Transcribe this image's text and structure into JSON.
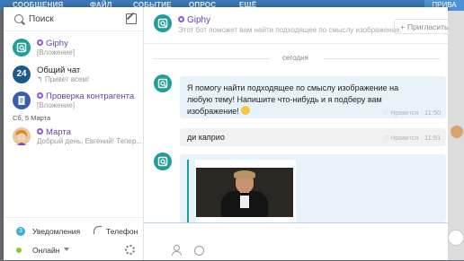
{
  "topbar": {
    "items": [
      "СООБЩЕНИЯ",
      "ФАЙЛ",
      "СОБЫТИЕ",
      "ОПРОС",
      "ЕЩЁ"
    ],
    "button": "ПРИВА"
  },
  "sidebar": {
    "search_placeholder": "Поиск",
    "chats": [
      {
        "name": "Giphy",
        "sub": "[Вложение]",
        "bot": true
      },
      {
        "name": "Общий чат",
        "sub": "Привет всем!",
        "bot": false,
        "avatar_text": "24"
      },
      {
        "name": "Проверка контрагента",
        "sub": "[Вложение]",
        "bot": true
      },
      {
        "name": "Марта",
        "sub": "Добрый день, Евгений! Тепер...",
        "bot": true
      }
    ],
    "date_separator": "Сб, 5 Марта",
    "notifications_count": "3",
    "notifications_label": "Уведомления",
    "phone_label": "Телефон",
    "status_label": "Онлайн"
  },
  "header": {
    "title": "Giphy",
    "subtitle": "Этот бот поможет вам найти подходящее по смыслу изображение.",
    "invite_label": "Пригласить"
  },
  "messages": {
    "day_separator": "сегодня",
    "m1_text": "Я помогу найти подходящее по смыслу изображение на любую тему! Напишите что-нибудь и я подберу вам изображение!",
    "m1_like": "Нравится",
    "m1_time": "11:50",
    "m2_text": "ди каприо",
    "m2_like": "Нравится",
    "m2_time": "11:51"
  },
  "colors": {
    "accent": "#1f9e9a",
    "bot_purple": "#6a3fa8",
    "topbar": "#3d7ab8",
    "bubble": "#e8f2fb"
  }
}
